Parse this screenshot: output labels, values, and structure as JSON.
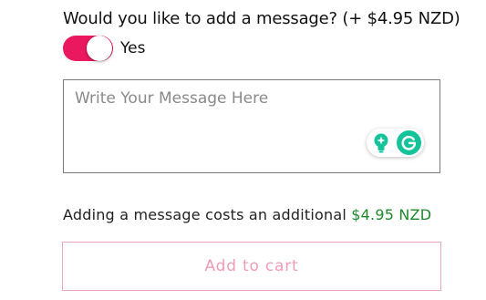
{
  "message_option": {
    "question": "Would you like to add a message? (+ $4.95 NZD)",
    "toggle_label": "Yes",
    "toggle_on": true,
    "toggle_color": "#e9185f"
  },
  "message_field": {
    "placeholder": "Write Your Message Here",
    "value": ""
  },
  "grammarly": {
    "icons": [
      "lightbulb-icon",
      "grammarly-g-icon"
    ],
    "bulb_color": "#15c39a",
    "g_color": "#15c39a"
  },
  "cost_note": {
    "text": "Adding a message costs an additional",
    "price": "$4.95 NZD",
    "price_color": "#1c8a2a"
  },
  "cart": {
    "button_label": "Add to cart",
    "button_color": "#ef9bb6"
  }
}
